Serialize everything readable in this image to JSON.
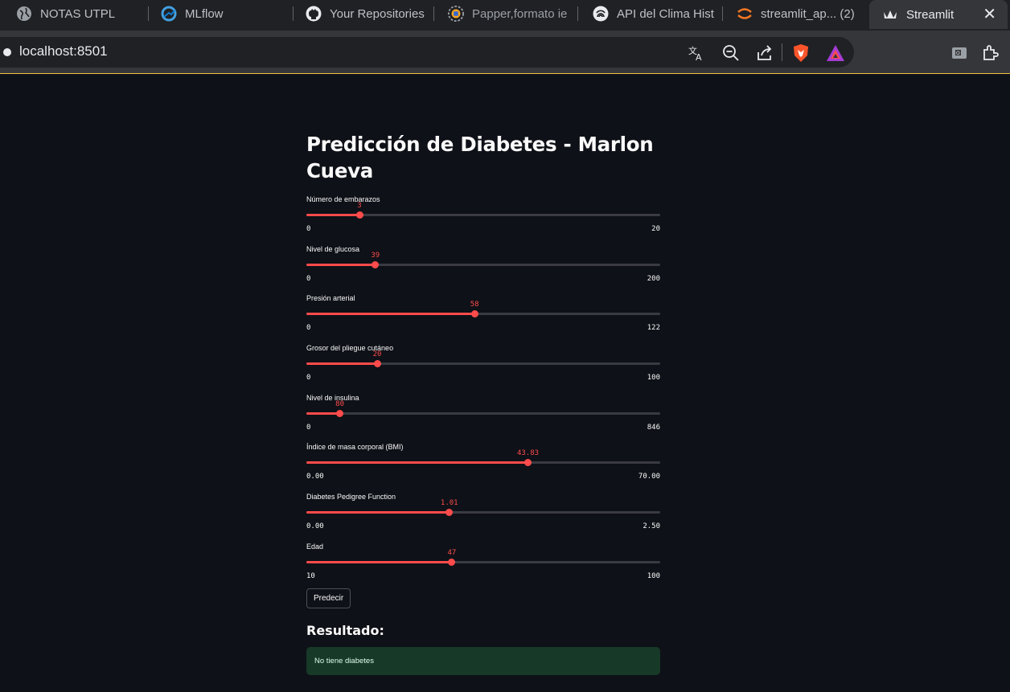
{
  "browser": {
    "tabs": [
      {
        "title": "NOTAS UTPL",
        "icon": "globe-icon"
      },
      {
        "title": "MLflow",
        "icon": "mlflow-icon"
      },
      {
        "title": "Your Repositories",
        "icon": "github-icon"
      },
      {
        "title": "Papper,formato ie",
        "icon": "paper-icon"
      },
      {
        "title": "API del Clima Hist",
        "icon": "weather-api-icon"
      },
      {
        "title": "streamlit_ap... (2)",
        "icon": "jupyter-icon"
      },
      {
        "title": "Streamlit",
        "icon": "streamlit-icon"
      }
    ],
    "active_tab_close": "✕",
    "url": "localhost:8501",
    "toolbar_icons": [
      "translate-icon",
      "zoom-out-icon",
      "share-icon",
      "brave-shields-icon",
      "brave-rewards-icon",
      "wallet-icon",
      "extensions-icon"
    ]
  },
  "app": {
    "title": "Predicción de Diabetes - Marlon Cueva",
    "sliders": [
      {
        "label": "Número de embarazos",
        "value": 3,
        "value_text": "3",
        "min": 0,
        "max": 20,
        "min_text": "0",
        "max_text": "20"
      },
      {
        "label": "Nivel de glucosa",
        "value": 39,
        "value_text": "39",
        "min": 0,
        "max": 200,
        "min_text": "0",
        "max_text": "200"
      },
      {
        "label": "Presión arterial",
        "value": 58,
        "value_text": "58",
        "min": 0,
        "max": 122,
        "min_text": "0",
        "max_text": "122"
      },
      {
        "label": "Grosor del pliegue cutáneo",
        "value": 20,
        "value_text": "20",
        "min": 0,
        "max": 100,
        "min_text": "0",
        "max_text": "100"
      },
      {
        "label": "Nivel de insulina",
        "value": 80,
        "value_text": "80",
        "min": 0,
        "max": 846,
        "min_text": "0",
        "max_text": "846"
      },
      {
        "label": "Índice de masa corporal (BMI)",
        "value": 43.83,
        "value_text": "43.83",
        "min": 0,
        "max": 70,
        "min_text": "0.00",
        "max_text": "70.00"
      },
      {
        "label": "Diabetes Pedigree Function",
        "value": 1.01,
        "value_text": "1.01",
        "min": 0,
        "max": 2.5,
        "min_text": "0.00",
        "max_text": "2.50"
      },
      {
        "label": "Edad",
        "value": 47,
        "value_text": "47",
        "min": 10,
        "max": 100,
        "min_text": "10",
        "max_text": "100"
      }
    ],
    "predict_button": "Predecir",
    "result_header": "Resultado:",
    "result_text": "No tiene diabetes"
  },
  "colors": {
    "background": "#0e1117",
    "accent": "#ff4b4b",
    "success_bg": "#173928"
  }
}
